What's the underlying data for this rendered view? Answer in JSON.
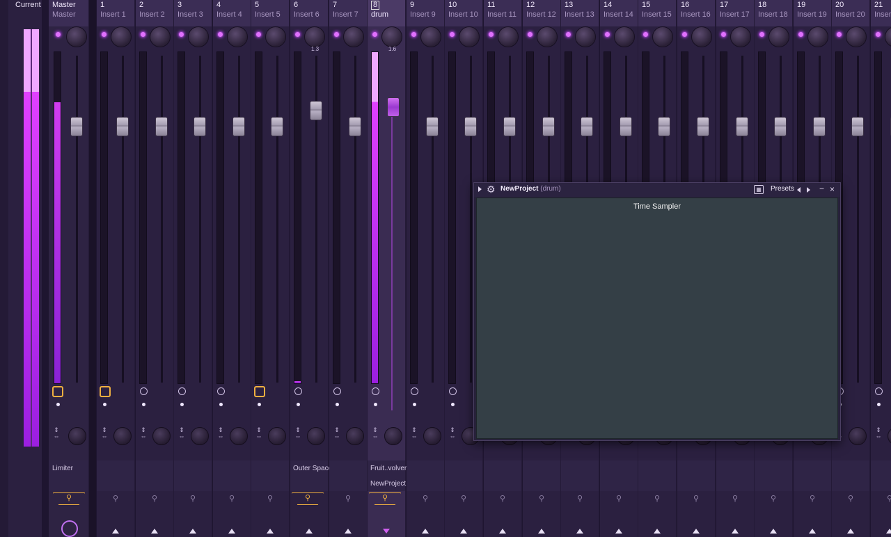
{
  "current": {
    "label": "Current"
  },
  "master": {
    "number": "Master",
    "name": "Master",
    "fx_slot": "Limiter"
  },
  "inserts": [
    {
      "number": "1",
      "name": "Insert 1",
      "clock_on": true
    },
    {
      "number": "2",
      "name": "Insert 2"
    },
    {
      "number": "3",
      "name": "Insert 3"
    },
    {
      "number": "4",
      "name": "Insert 4"
    },
    {
      "number": "5",
      "name": "Insert 5",
      "clock_on": true
    },
    {
      "number": "6",
      "name": "Insert 6",
      "volume": "1.3",
      "fx_slot": "Outer Space",
      "route_on": true
    },
    {
      "number": "7",
      "name": "Insert 7"
    },
    {
      "number": "8",
      "name": "drum",
      "volume": "1.6",
      "fx_slot": "Fruit..volver",
      "fx_slot2": "NewProject",
      "selected": true,
      "route_on": true
    },
    {
      "number": "9",
      "name": "Insert 9"
    },
    {
      "number": "10",
      "name": "Insert 10"
    },
    {
      "number": "11",
      "name": "Insert 11"
    },
    {
      "number": "12",
      "name": "Insert 12"
    },
    {
      "number": "13",
      "name": "Insert 13"
    },
    {
      "number": "14",
      "name": "Insert 14"
    },
    {
      "number": "15",
      "name": "Insert 15"
    },
    {
      "number": "16",
      "name": "Insert 16"
    },
    {
      "number": "17",
      "name": "Insert 17"
    },
    {
      "number": "18",
      "name": "Insert 18"
    },
    {
      "number": "19",
      "name": "Insert 19"
    },
    {
      "number": "20",
      "name": "Insert 20"
    },
    {
      "number": "21",
      "name": "Insert 21"
    }
  ],
  "plugin": {
    "title": "NewProject",
    "title_suffix": "(drum)",
    "presets_label": "Presets",
    "plugin_name": "Time Sampler",
    "minimize": "−",
    "close": "×"
  },
  "colors": {
    "accent": "#c040ff",
    "highlight": "#f0b040",
    "plugin_bg": "#343f46"
  }
}
